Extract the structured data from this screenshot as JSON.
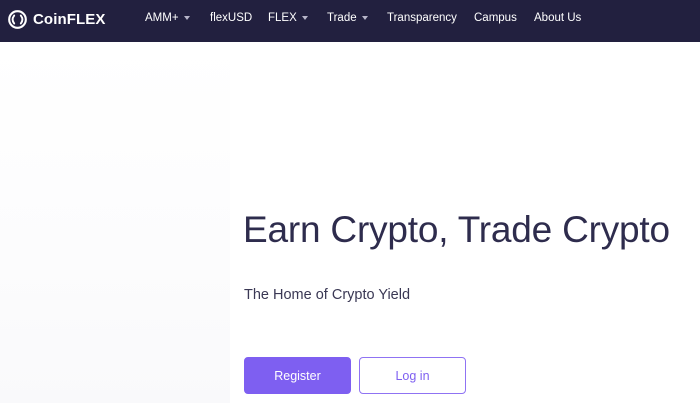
{
  "brand": {
    "name": "CoinFLEX"
  },
  "nav": {
    "items": [
      {
        "label": "AMM+",
        "has_dropdown": true
      },
      {
        "label": "flexUSD",
        "has_dropdown": false
      },
      {
        "label": "FLEX",
        "has_dropdown": true
      },
      {
        "label": "Trade",
        "has_dropdown": true
      },
      {
        "label": "Transparency",
        "has_dropdown": false
      },
      {
        "label": "Campus",
        "has_dropdown": false
      },
      {
        "label": "About Us",
        "has_dropdown": false
      }
    ]
  },
  "hero": {
    "title": "Earn Crypto, Trade Crypto",
    "subtitle": "The Home of Crypto Yield",
    "register_label": "Register",
    "login_label": "Log in"
  },
  "colors": {
    "nav_background": "#22203f",
    "accent": "#7e5ff1",
    "heading": "#2e2c4d"
  },
  "icons": {
    "logo": "coinflex-logo-icon",
    "dropdown": "caret-down-icon"
  }
}
